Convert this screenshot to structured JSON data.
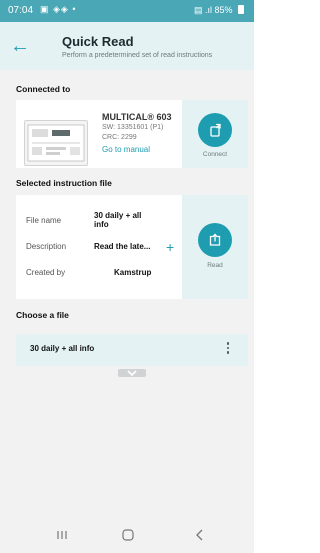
{
  "status_bar": {
    "time": "07:04",
    "battery": "85%"
  },
  "header": {
    "title": "Quick Read",
    "subtitle": "Perform a predetermined set of read instructions",
    "back_icon": "arrow-left-icon"
  },
  "connected": {
    "heading": "Connected to",
    "device_name": "MULTICAL® 603",
    "sw": "SW: 13351601 (P1)",
    "crc": "CRC: 2299",
    "manual_link": "Go to manual",
    "action_label": "Connect",
    "action_icon": "connect-device-icon"
  },
  "instruction": {
    "heading": "Selected instruction file",
    "file_name_label": "File name",
    "file_name_value_line1": "30 daily + all",
    "file_name_value_line2": "info",
    "description_label": "Description",
    "description_value": "Read the late...",
    "created_by_label": "Created by",
    "created_by_value": "Kamstrup",
    "action_label": "Read",
    "action_icon": "read-export-icon"
  },
  "choose": {
    "heading": "Choose a file",
    "selected_file": "30 daily + all info"
  },
  "colors": {
    "accent": "#1f9db0",
    "status_bar": "#4aa7b6",
    "panel": "#e4f2f4"
  }
}
